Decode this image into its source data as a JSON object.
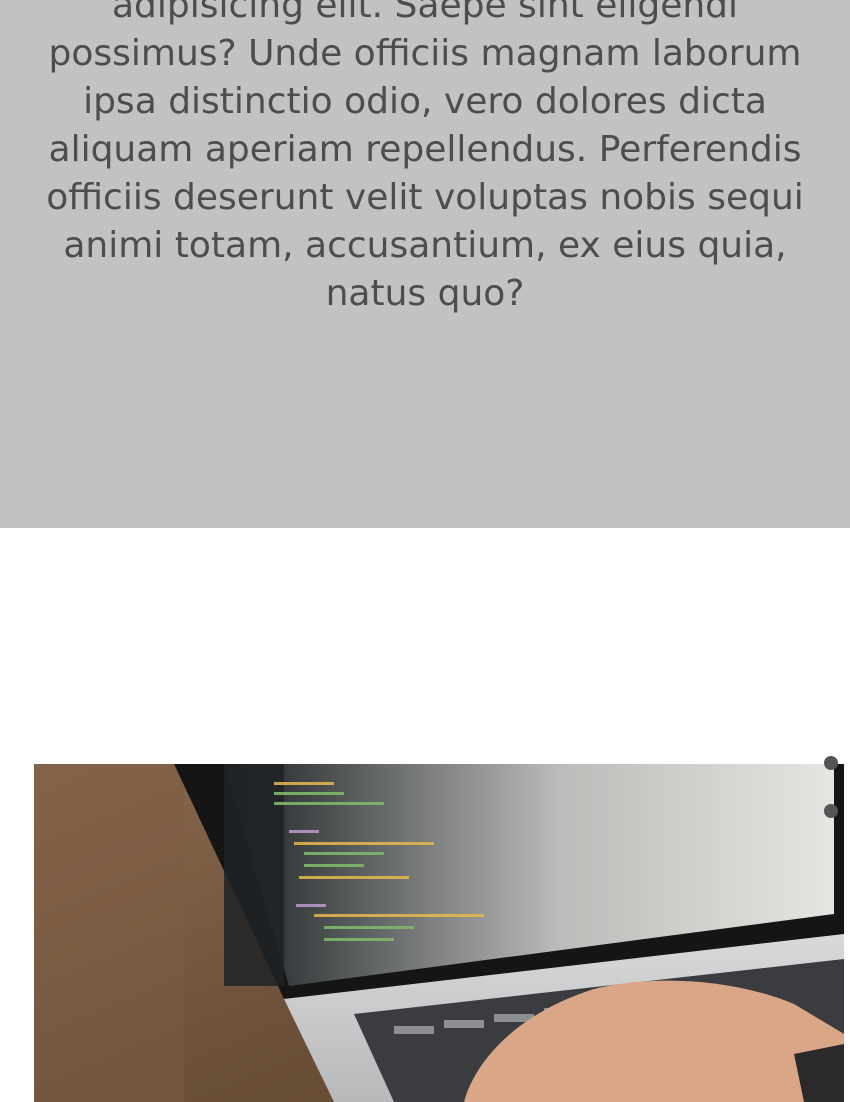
{
  "hero": {
    "paragraph": "adipisicing elit. Saepe sint eligendi possimus? Unde officiis magnam laborum ipsa distinctio odio, vero dolores dicta aliquam aperiam repellendus. Perferendis officiis deserunt velit voluptas nobis sequi animi totam, accusantium, ex eius quia, natus quo?",
    "background": "#c2c2c2",
    "text_color": "#4d4d4d"
  },
  "photo": {
    "subject": "laptop-code-photo"
  },
  "pagination": {
    "dots": 2,
    "color": "#555555"
  }
}
